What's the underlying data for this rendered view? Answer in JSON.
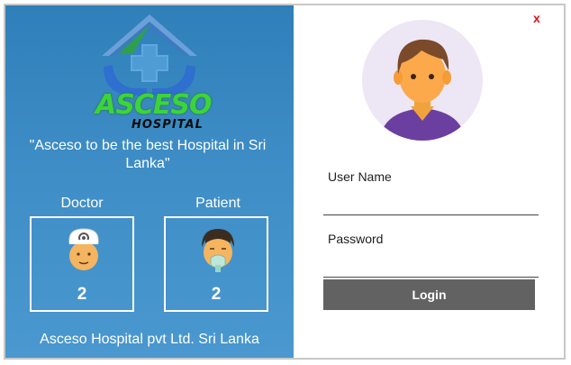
{
  "branding": {
    "name": "ASCESO",
    "subtitle": "HOSPITAL",
    "slogan": "\"Asceso to be the best Hospital in Sri Lanka\"",
    "footer": "Asceso Hospital pvt Ltd. Sri Lanka"
  },
  "stats": {
    "doctor": {
      "label": "Doctor",
      "count": "2"
    },
    "patient": {
      "label": "Patient",
      "count": "2"
    }
  },
  "login": {
    "close_label": "x",
    "username_label": "User Name",
    "username_value": "",
    "password_label": "Password",
    "password_value": "",
    "button_label": "Login"
  },
  "colors": {
    "panel_blue": "#3a88c2",
    "brand_green": "#3cd43a",
    "close_red": "#e2101c",
    "button_gray": "#626262",
    "avatar_bg": "#ede6f5",
    "avatar_shirt": "#6b3fa0"
  },
  "icons": {
    "logo": "hospital-house-hands-icon",
    "doctor": "doctor-face-icon",
    "patient": "patient-mask-icon",
    "avatar": "user-avatar-icon"
  }
}
